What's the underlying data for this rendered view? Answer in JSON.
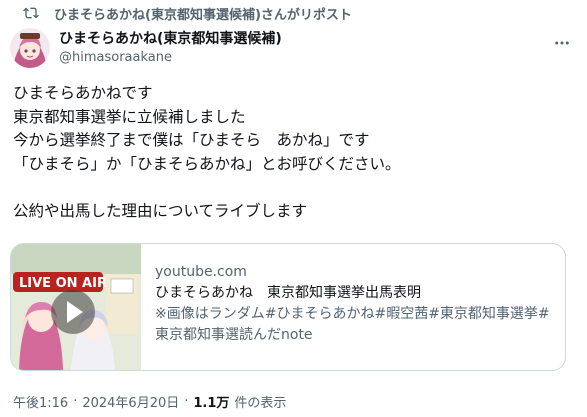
{
  "repost": {
    "icon": "repost-icon",
    "text": "ひまそらあかね(東京都知事選候補)さんがリポスト"
  },
  "author": {
    "display_name": "ひまそらあかね(東京都知事選候補)",
    "handle": "@himasoraakane",
    "avatar_icon": "avatar-image"
  },
  "more_icon": "more-icon",
  "tweet": {
    "lines": [
      "ひまそらあかねです",
      "東京都知事選挙に立候補しました",
      "今から選挙終了まで僕は「ひまそら　あかね」です",
      "「ひまそら」か「ひまそらあかね」とお呼びください。",
      "",
      "公約や出馬した理由についてライブします"
    ]
  },
  "card": {
    "domain": "youtube.com",
    "title": "ひまそらあかね　東京都知事選挙出馬表明",
    "description": "※画像はランダム#ひまそらあかね#暇空茜#東京都知事選挙#東京都知事選読んだnote",
    "thumbnail_text": "LIVE ON AIR"
  },
  "meta": {
    "time": "午後1:16",
    "date": "2024年6月20日",
    "separator": "·",
    "views_count": "1.1万",
    "views_label": "件の表示"
  },
  "colors": {
    "text_primary": "#0f1419",
    "text_secondary": "#536471",
    "border": "#cfd9de"
  }
}
